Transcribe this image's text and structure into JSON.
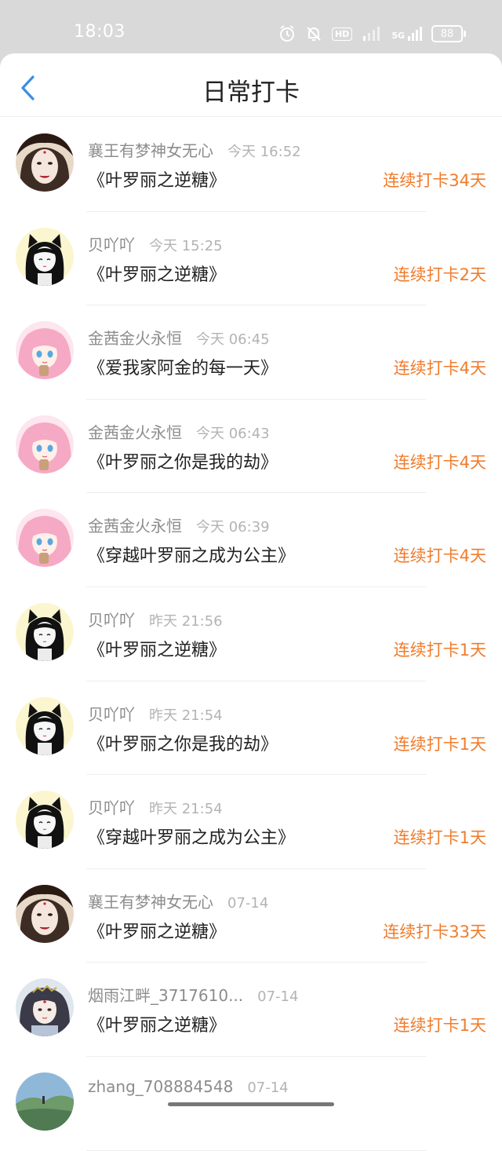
{
  "status_bar": {
    "time": "18:03",
    "icons": [
      "alarm-icon",
      "mute-icon",
      "hd-icon",
      "signal-icon",
      "5g-signal-icon",
      "battery-icon"
    ],
    "hd_label": "HD",
    "network_label": "5G",
    "battery_level": "88"
  },
  "header": {
    "title": "日常打卡",
    "back_icon": "chevron-left-icon"
  },
  "colors": {
    "accent_back": "#3a8ee6",
    "streak": "#f07c2c",
    "username": "#8c8c8c",
    "time": "#b3b3b3"
  },
  "feed": {
    "items": [
      {
        "username": "襄王有梦神女无心",
        "time": "今天 16:52",
        "book": "《叶罗丽之逆糖》",
        "streak": "连续打卡34天",
        "avatar": "avatar-woman-a"
      },
      {
        "username": "贝吖吖",
        "time": "今天 15:25",
        "book": "《叶罗丽之逆糖》",
        "streak": "连续打卡2天",
        "avatar": "avatar-cat-girl"
      },
      {
        "username": "金茜金火永恒",
        "time": "今天 06:45",
        "book": "《爱我家阿金的每一天》",
        "streak": "连续打卡4天",
        "avatar": "avatar-pink-hair"
      },
      {
        "username": "金茜金火永恒",
        "time": "今天 06:43",
        "book": "《叶罗丽之你是我的劫》",
        "streak": "连续打卡4天",
        "avatar": "avatar-pink-hair"
      },
      {
        "username": "金茜金火永恒",
        "time": "今天 06:39",
        "book": "《穿越叶罗丽之成为公主》",
        "streak": "连续打卡4天",
        "avatar": "avatar-pink-hair"
      },
      {
        "username": "贝吖吖",
        "time": "昨天 21:56",
        "book": "《叶罗丽之逆糖》",
        "streak": "连续打卡1天",
        "avatar": "avatar-cat-girl"
      },
      {
        "username": "贝吖吖",
        "time": "昨天 21:54",
        "book": "《叶罗丽之你是我的劫》",
        "streak": "连续打卡1天",
        "avatar": "avatar-cat-girl"
      },
      {
        "username": "贝吖吖",
        "time": "昨天 21:54",
        "book": "《穿越叶罗丽之成为公主》",
        "streak": "连续打卡1天",
        "avatar": "avatar-cat-girl"
      },
      {
        "username": "襄王有梦神女无心",
        "time": "07-14",
        "book": "《叶罗丽之逆糖》",
        "streak": "连续打卡33天",
        "avatar": "avatar-woman-a"
      },
      {
        "username": "烟雨江畔_3717610...",
        "time": "07-14",
        "book": "《叶罗丽之逆糖》",
        "streak": "连续打卡1天",
        "avatar": "avatar-ancient-girl"
      },
      {
        "username": "zhang_708884548",
        "time": "07-14",
        "book": "",
        "streak": "",
        "avatar": "avatar-landscape"
      }
    ]
  }
}
